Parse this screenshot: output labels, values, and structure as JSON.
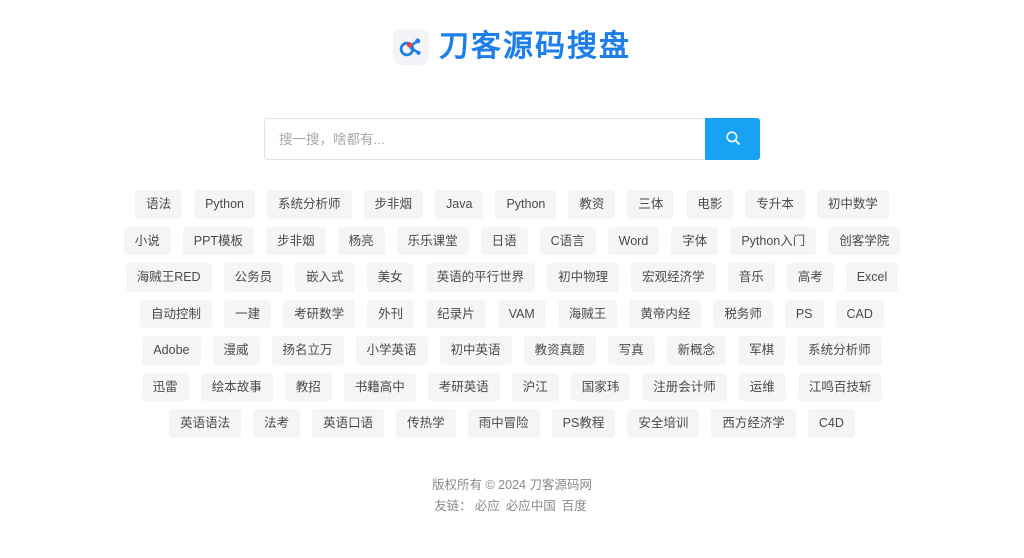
{
  "site": {
    "logo_icon": "molecule-logo-icon",
    "title": "刀客源码搜盘",
    "brand_color": "#1f7fe8",
    "accent_color": "#17a2f3"
  },
  "search": {
    "placeholder": "搜一搜，啥都有...",
    "value": "",
    "button_icon": "search-icon"
  },
  "tags": [
    "语法",
    "Python",
    "系统分析师",
    "步非烟",
    "Java",
    "Python",
    "教资",
    "三体",
    "电影",
    "专升本",
    "初中数学",
    "小说",
    "PPT模板",
    "步非烟",
    "杨亮",
    "乐乐课堂",
    "日语",
    "C语言",
    "Word",
    "字体",
    "Python入门",
    "创客学院",
    "海贼王RED",
    "公务员",
    "嵌入式",
    "美女",
    "英语的平行世界",
    "初中物理",
    "宏观经济学",
    "音乐",
    "高考",
    "Excel",
    "自动控制",
    "一建",
    "考研数学",
    "外刊",
    "纪录片",
    "VAM",
    "海贼王",
    "黄帝内经",
    "税务师",
    "PS",
    "CAD",
    "Adobe",
    "漫威",
    "扬名立万",
    "小学英语",
    "初中英语",
    "教资真题",
    "写真",
    "新概念",
    "军棋",
    "系统分析师",
    "迅雷",
    "绘本故事",
    "教招",
    "书籍高中",
    "考研英语",
    "沪江",
    "国家玮",
    "注册会计师",
    "运维",
    "江鸣百技斩",
    "英语语法",
    "法考",
    "英语口语",
    "传热学",
    "雨中冒险",
    "PS教程",
    "安全培训",
    "西方经济学",
    "C4D"
  ],
  "footer": {
    "copyright": "版权所有 © 2024 刀客源码网",
    "links_label": "友链：",
    "links": [
      "必应",
      "必应中国",
      "百度"
    ]
  }
}
